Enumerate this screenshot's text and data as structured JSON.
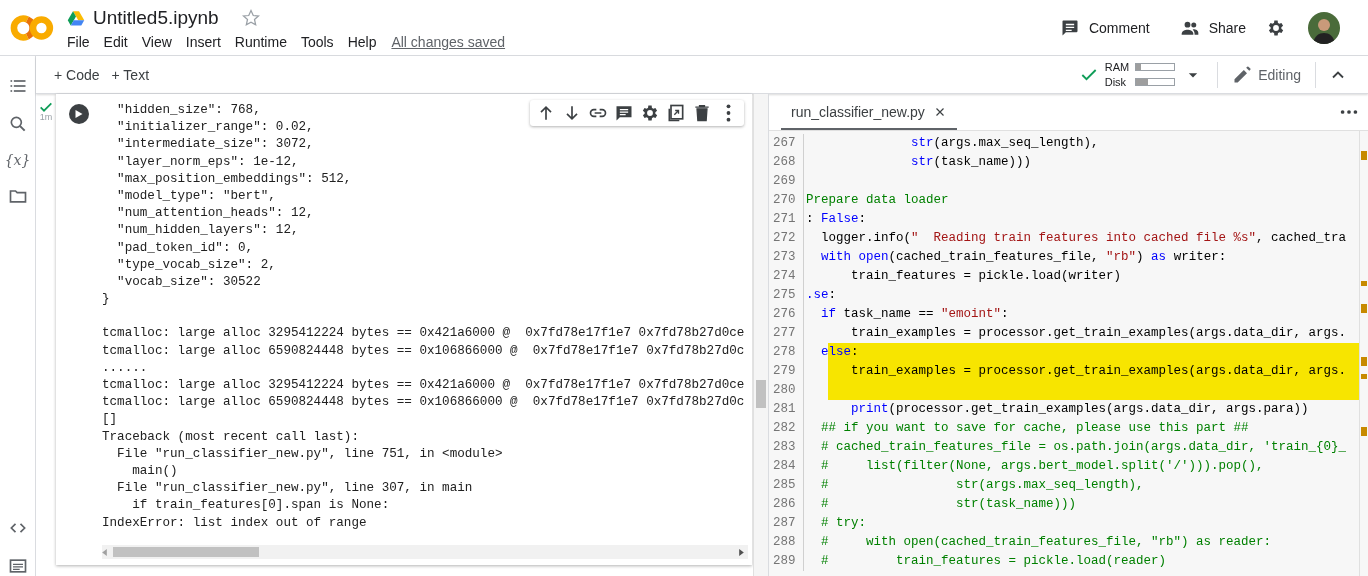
{
  "header": {
    "title": "Untitled5.ipynb",
    "starred": false,
    "menu": [
      "File",
      "Edit",
      "View",
      "Insert",
      "Runtime",
      "Tools",
      "Help"
    ],
    "save_status": "All changes saved",
    "actions": [
      {
        "kind": "comment",
        "label": "Comment"
      },
      {
        "kind": "share",
        "label": "Share"
      }
    ]
  },
  "sidebar": {
    "variables_glyph": "{x}"
  },
  "toolbar": {
    "add_buttons": [
      "+ Code",
      "+ Text"
    ],
    "connected": true,
    "meters": [
      {
        "label": "RAM",
        "level": 0.12
      },
      {
        "label": "Disk",
        "level": 0.3
      }
    ],
    "mode": "Editing"
  },
  "cell": {
    "executed": true,
    "exec_time": "1m",
    "output": [
      [
        "  \"hidden_size\": 768,",
        "  \"initializer_range\": 0.02,",
        "  \"intermediate_size\": 3072,",
        "  \"layer_norm_eps\": 1e-12,",
        "  \"max_position_embeddings\": 512,",
        "  \"model_type\": \"bert\",",
        "  \"num_attention_heads\": 12,",
        "  \"num_hidden_layers\": 12,",
        "  \"pad_token_id\": 0,",
        "  \"type_vocab_size\": 2,",
        "  \"vocab_size\": 30522",
        "}"
      ],
      [
        "tcmalloc: large alloc 3295412224 bytes == 0x421a6000 @  0x7fd78e17f1e7 0x7fd78b27d0ce",
        "tcmalloc: large alloc 6590824448 bytes == 0x106866000 @  0x7fd78e17f1e7 0x7fd78b27d0c",
        "......",
        "tcmalloc: large alloc 3295412224 bytes == 0x421a6000 @  0x7fd78e17f1e7 0x7fd78b27d0ce",
        "tcmalloc: large alloc 6590824448 bytes == 0x106866000 @  0x7fd78e17f1e7 0x7fd78b27d0c",
        "[]",
        "Traceback (most recent call last):",
        "  File \"run_classifier_new.py\", line 751, in <module>",
        "    main()",
        "  File \"run_classifier_new.py\", line 307, in main",
        "    if train_features[0].span is None:",
        "IndexError: list index out of range"
      ]
    ]
  },
  "editor": {
    "tabs": [
      {
        "label": "run_classifier_new.py",
        "selected": true
      }
    ],
    "lines": [
      {
        "num": "267",
        "highlighted": false,
        "tokens": [
          {
            "kind": "kw",
            "text": "              str"
          },
          {
            "kind": "plain",
            "text": "(args.max_seq_length),"
          }
        ]
      },
      {
        "num": "268",
        "highlighted": false,
        "tokens": [
          {
            "kind": "kw",
            "text": "              str"
          },
          {
            "kind": "plain",
            "text": "(task_name)))"
          }
        ]
      },
      {
        "num": "269",
        "highlighted": false
      },
      {
        "num": "270",
        "highlighted": false,
        "tokens": [
          {
            "kind": "comment",
            "text": "Prepare data loader"
          }
        ]
      },
      {
        "num": "271",
        "highlighted": false,
        "tokens": [
          {
            "kind": "plain",
            "text": ": "
          },
          {
            "kind": "kw",
            "text": "False"
          },
          {
            "kind": "plain",
            "text": ":"
          }
        ]
      },
      {
        "num": "272",
        "highlighted": false,
        "tokens": [
          {
            "kind": "plain",
            "text": "  logger.info("
          },
          {
            "kind": "str",
            "text": "\"  Reading train features into cached file %s\""
          },
          {
            "kind": "plain",
            "text": ", cached_tra"
          }
        ]
      },
      {
        "num": "273",
        "highlighted": false,
        "tokens": [
          {
            "kind": "kw",
            "text": "  with"
          },
          {
            "kind": "kw",
            "text": " open"
          },
          {
            "kind": "plain",
            "text": "(cached_train_features_file, "
          },
          {
            "kind": "str",
            "text": "\"rb\""
          },
          {
            "kind": "plain",
            "text": ") "
          },
          {
            "kind": "kw",
            "text": "as"
          },
          {
            "kind": "plain",
            "text": " writer:"
          }
        ]
      },
      {
        "num": "274",
        "highlighted": false,
        "tokens": [
          {
            "kind": "plain",
            "text": "      train_features = pickle.load(writer)"
          }
        ]
      },
      {
        "num": "275",
        "highlighted": false,
        "tokens": [
          {
            "kind": "kw",
            "text": ".se"
          },
          {
            "kind": "plain",
            "text": ":"
          }
        ]
      },
      {
        "num": "276",
        "highlighted": false,
        "tokens": [
          {
            "kind": "kw",
            "text": "  if"
          },
          {
            "kind": "plain",
            "text": " task_name == "
          },
          {
            "kind": "str",
            "text": "\"emoint\""
          },
          {
            "kind": "plain",
            "text": ":"
          }
        ]
      },
      {
        "num": "277",
        "highlighted": false,
        "tokens": [
          {
            "kind": "plain",
            "text": "      train_examples = processor.get_train_examples(args.data_dir, args."
          }
        ]
      },
      {
        "num": "278",
        "highlighted": true,
        "tokens": [
          {
            "kind": "kw",
            "text": "  else"
          },
          {
            "kind": "plain",
            "text": ":"
          }
        ]
      },
      {
        "num": "279",
        "highlighted": true,
        "tokens": [
          {
            "kind": "plain",
            "text": "      train_examples = processor.get_train_examples(args.data_dir, args."
          }
        ]
      },
      {
        "num": "280",
        "highlighted": true
      },
      {
        "num": "281",
        "highlighted": false,
        "tokens": [
          {
            "kind": "kw",
            "text": "      print"
          },
          {
            "kind": "plain",
            "text": "(processor.get_train_examples(args.data_dir, args.para))"
          }
        ]
      },
      {
        "num": "282",
        "highlighted": false,
        "tokens": [
          {
            "kind": "comment",
            "text": "  ## if you want to save for cache, please use this part ##"
          }
        ]
      },
      {
        "num": "283",
        "highlighted": false,
        "tokens": [
          {
            "kind": "comment",
            "text": "  # cached_train_features_file = os.path.join(args.data_dir, 'train_{0}_"
          }
        ]
      },
      {
        "num": "284",
        "highlighted": false,
        "tokens": [
          {
            "kind": "comment",
            "text": "  #     list(filter(None, args.bert_model.split('/'))).pop(),"
          }
        ]
      },
      {
        "num": "285",
        "highlighted": false,
        "tokens": [
          {
            "kind": "comment",
            "text": "  #                 str(args.max_seq_length),"
          }
        ]
      },
      {
        "num": "286",
        "highlighted": false,
        "tokens": [
          {
            "kind": "comment",
            "text": "  #                 str(task_name)))"
          }
        ]
      },
      {
        "num": "287",
        "highlighted": false,
        "tokens": [
          {
            "kind": "comment",
            "text": "  # try:"
          }
        ]
      },
      {
        "num": "288",
        "highlighted": false,
        "tokens": [
          {
            "kind": "comment",
            "text": "  #     with open(cached_train_features_file, \"rb\") as reader:"
          }
        ]
      },
      {
        "num": "289",
        "highlighted": false,
        "tokens": [
          {
            "kind": "comment",
            "text": "  #         train_features = pickle.load(reader)"
          }
        ]
      }
    ]
  }
}
